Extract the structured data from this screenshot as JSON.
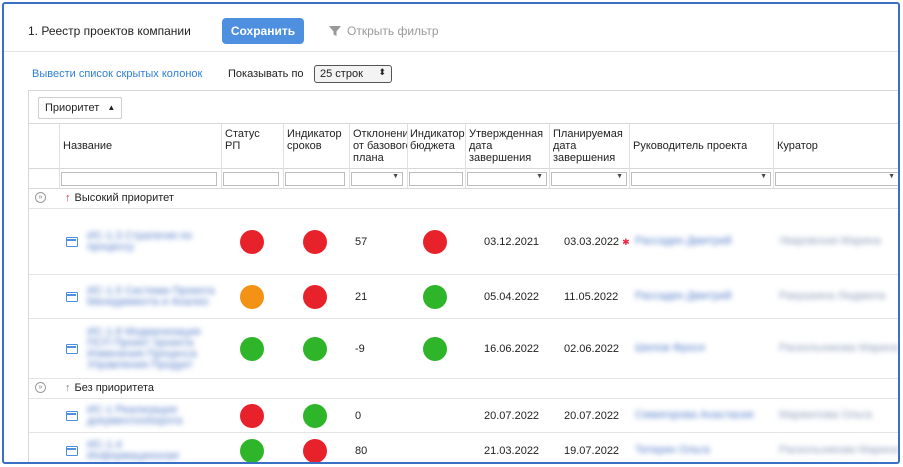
{
  "toolbar": {
    "title": "1. Реестр проектов компании",
    "save_label": "Сохранить",
    "filter_label": "Открыть фильтр"
  },
  "controls": {
    "show_hidden_label": "Вывести список скрытых колонок",
    "show_label": "Показывать по",
    "rows_per_page": "25 строк"
  },
  "grouping": {
    "chip_label": "Приоритет"
  },
  "columns": {
    "name": "Название",
    "status": "Статус\nРП",
    "deadline": "Индикатор\nсроков",
    "deviation": "Отклонение\nот базового\nплана",
    "budget": "Индикатор\nбюджета",
    "approved": "Утвержденная\nдата\nзавершения",
    "planned": "Планируемая\nдата\nзавершения",
    "manager": "Руководитель проекта",
    "curator": "Куратор"
  },
  "colors": {
    "red": "#e8222b",
    "orange": "#f39214",
    "green": "#2fb52a",
    "accent": "#4f8fe0"
  },
  "groups": [
    {
      "label": "Высокий приоритет",
      "arrow": "↑",
      "arrow_color": "#d33"
    },
    {
      "label": "Без приоритета",
      "arrow": "↑",
      "arrow_color": "#888"
    }
  ],
  "rows": [
    {
      "name": "ИС-1.3 Стратегия по процессу",
      "status": "red",
      "deadline": "red",
      "deviation": "57",
      "budget": "red",
      "approved": "03.12.2021",
      "planned": "03.03.2022",
      "manager": "Рассадин Дмитрий",
      "curator": "Уваровская Марина"
    },
    {
      "name": "ИС-1.5 Система Проекта Менеджмента и Анализ",
      "status": "orange",
      "deadline": "red",
      "deviation": "21",
      "budget": "green",
      "approved": "05.04.2022",
      "planned": "11.05.2022",
      "manager": "Рассадин Дмитрий",
      "curator": "Ракушкина Людмила"
    },
    {
      "name": "ИС-1.8 Модернизация ПСП Проект проекта Изменения Процесса Управления Продукт",
      "status": "green",
      "deadline": "green",
      "deviation": "-9",
      "budget": "green",
      "approved": "16.06.2022",
      "planned": "02.06.2022",
      "manager": "Шилов Фрося",
      "curator": "Раскольникова Марина"
    },
    {
      "name": "ИС-1 Реализация документооборота",
      "status": "red",
      "deadline": "green",
      "deviation": "0",
      "budget": "",
      "approved": "20.07.2022",
      "planned": "20.07.2022",
      "manager": "Семигорова Анастасия",
      "curator": "Маржилова Ольга"
    },
    {
      "name": "ИС-1.4 Информационная безопасность",
      "status": "green",
      "deadline": "red",
      "deviation": "80",
      "budget": "",
      "approved": "21.03.2022",
      "planned": "19.07.2022",
      "manager": "Тетерин Ольга",
      "curator": "Раскольникова Марина"
    }
  ]
}
